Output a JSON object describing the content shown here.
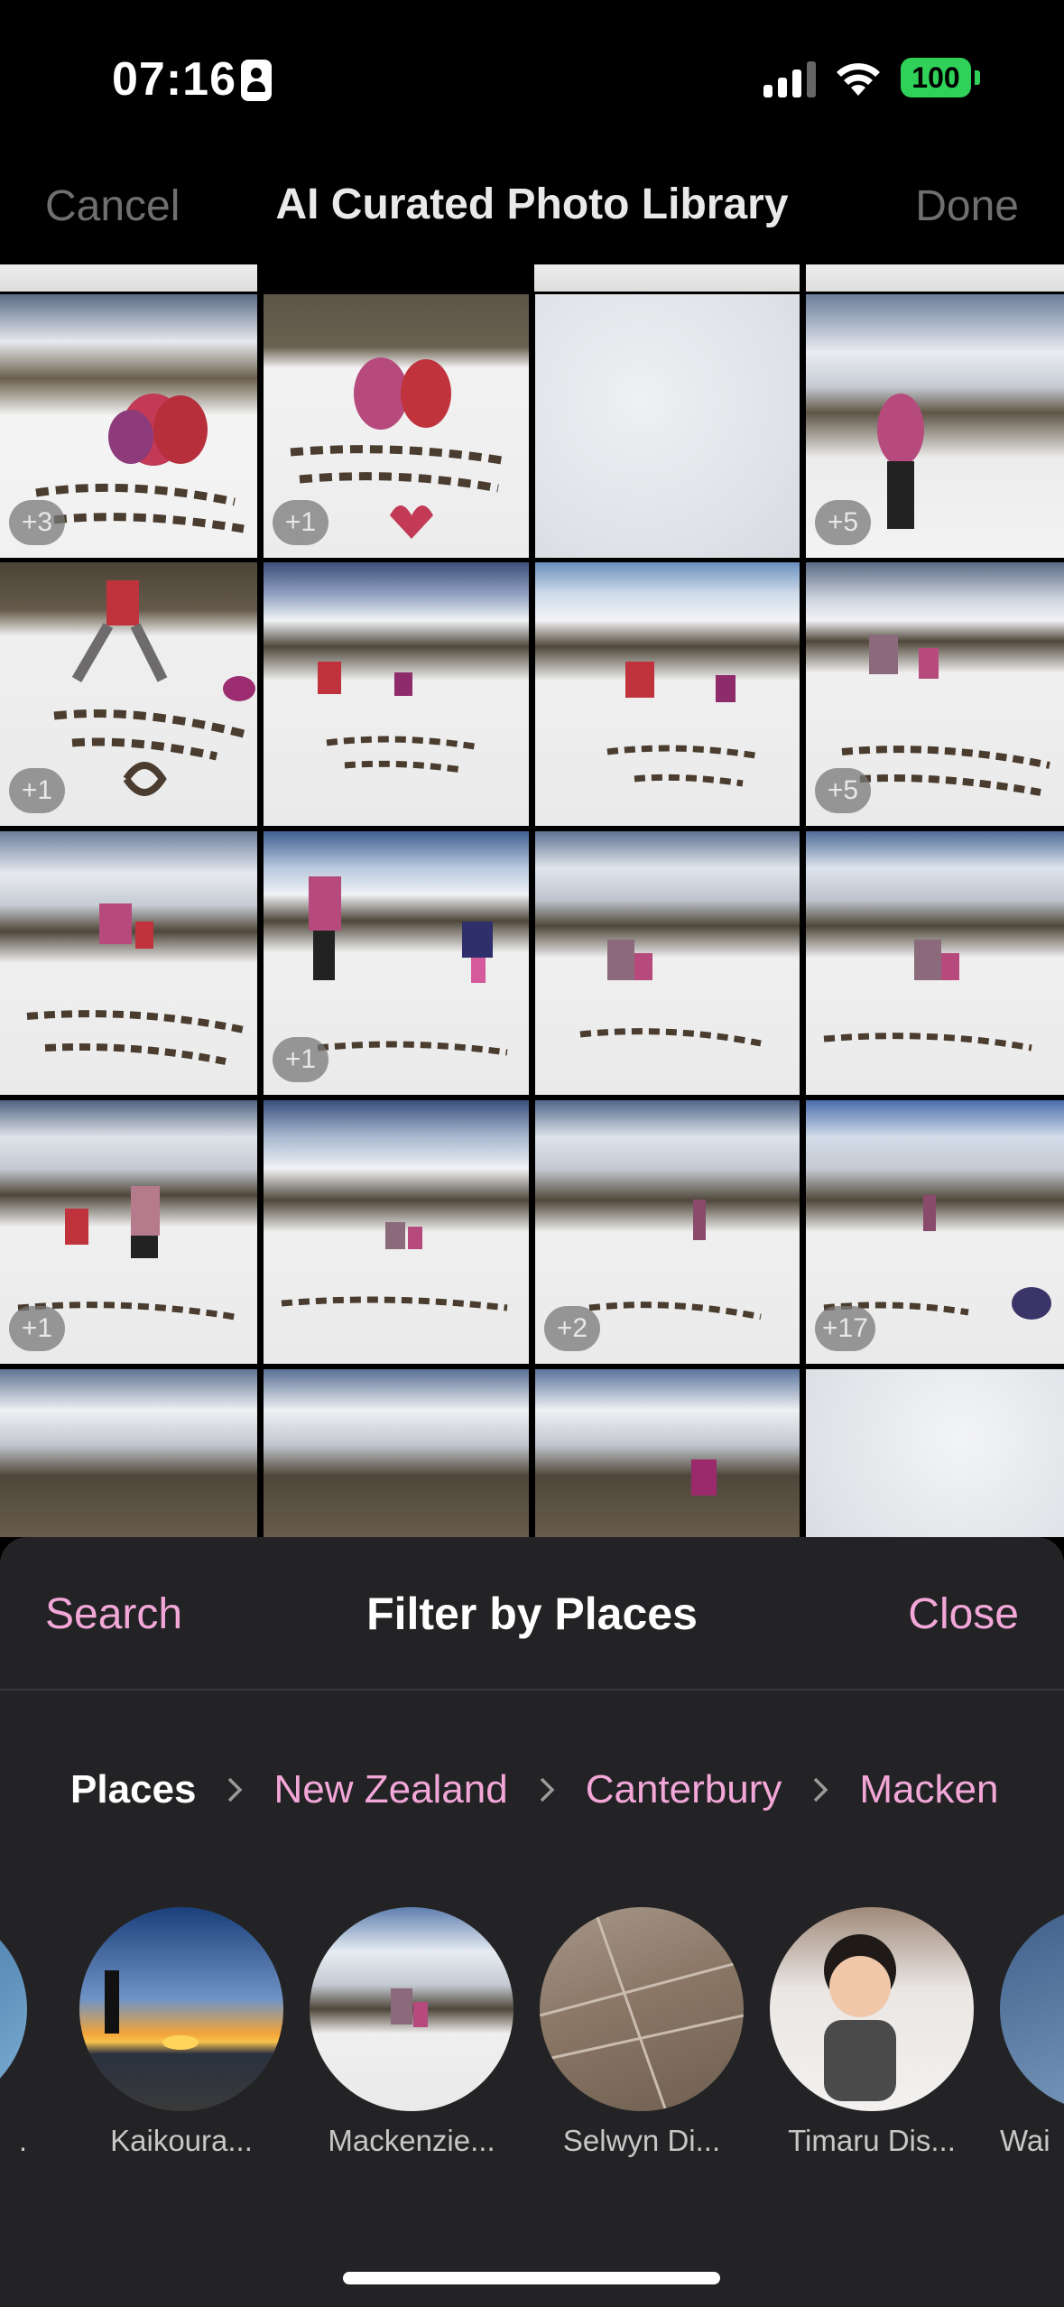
{
  "status": {
    "time": "07:16",
    "battery": "100"
  },
  "nav": {
    "cancel": "Cancel",
    "title": "AI Curated Photo Library",
    "done": "Done"
  },
  "grid": {
    "badges": [
      "+3",
      "+1",
      "+5",
      "+1",
      "+5",
      "+1",
      "+1",
      "+2",
      "+17"
    ]
  },
  "sheet": {
    "search": "Search",
    "title": "Filter by Places",
    "close": "Close",
    "breadcrumb": [
      "Places",
      "New Zealand",
      "Canterbury",
      "Macken"
    ],
    "places": [
      ".",
      "Kaikoura...",
      "Mackenzie...",
      "Selwyn Di...",
      "Timaru Dis...",
      "Wai"
    ]
  },
  "colors": {
    "accent": "#f3a7d8",
    "battery": "#30d158",
    "sheet": "#232325"
  }
}
